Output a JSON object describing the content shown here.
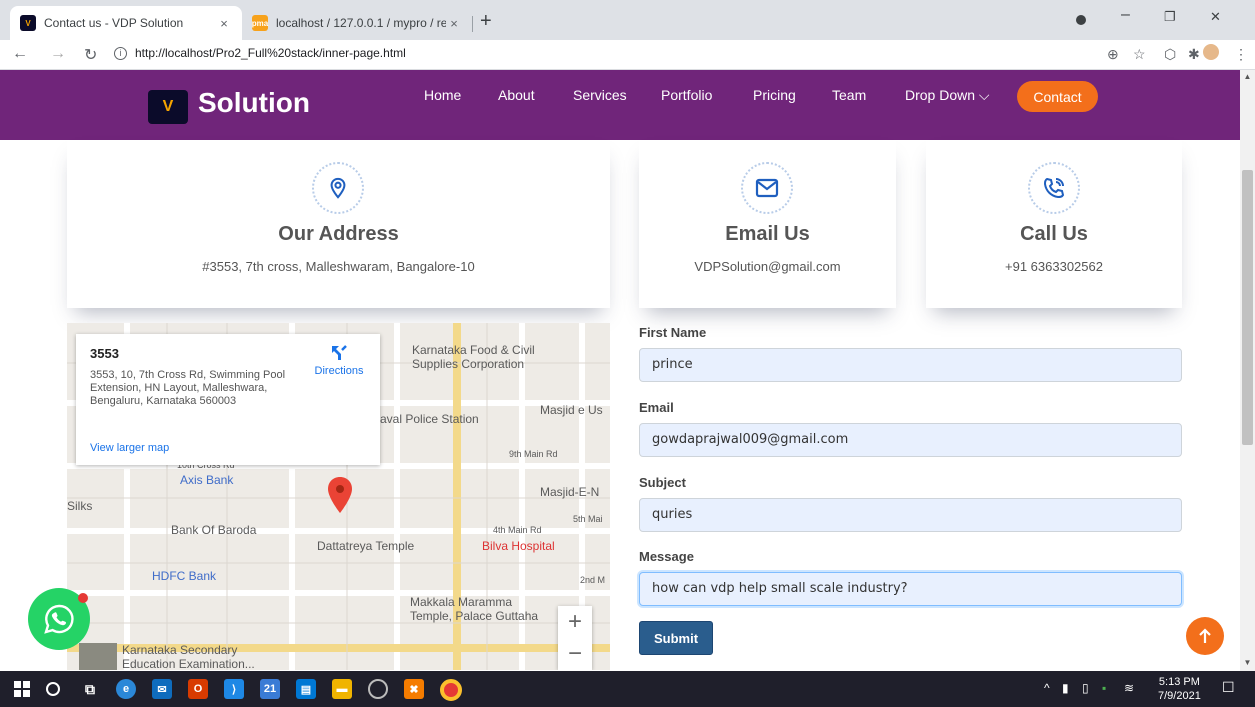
{
  "browser": {
    "tabs": [
      {
        "title": "Contact us - VDP Solution",
        "close": "×"
      },
      {
        "title": "localhost / 127.0.0.1 / mypro / re",
        "close": "×"
      }
    ],
    "new_tab": "+",
    "window_controls": {
      "minimize": "–",
      "maximize": "❐",
      "close": "✕"
    },
    "url": "http://localhost/Pro2_Full%20stack/inner-page.html"
  },
  "header": {
    "logo_mark": "V",
    "logo_text": "Solution",
    "nav": [
      "Home",
      "About",
      "Services",
      "Portfolio",
      "Pricing",
      "Team",
      "Drop Down ⌵"
    ],
    "contact_button": "Contact"
  },
  "info_boxes": [
    {
      "icon": "location-icon",
      "title": "Our Address",
      "text": "#3553, 7th cross, Malleshwaram, Bangalore-10"
    },
    {
      "icon": "envelope-icon",
      "title": "Email Us",
      "text": "VDPSolution@gmail.com"
    },
    {
      "icon": "phone-icon",
      "title": "Call Us",
      "text": "+91 6363302562"
    }
  ],
  "map": {
    "place": "3553",
    "address": "3553, 10, 7th Cross Rd, Swimming Pool Extension, HN Layout, Malleshwara, Bengaluru, Karnataka 560003",
    "directions": "Directions",
    "view_larger": "View larger map",
    "zoom_in": "+",
    "zoom_out": "−",
    "labels": {
      "karnataka_food": "Karnataka Food & Civil",
      "supplies": "Supplies Corporation",
      "masjid_e_u": "Masjid e Us",
      "police_station": "aval Police Station",
      "ninth_main": "9th Main Rd",
      "tenth_cross": "10th Cross Rd",
      "axis_bank": "Axis Bank",
      "silks": "Silks",
      "masjid_e_n": "Masjid-E-N",
      "fifth_main": "5th Mai",
      "bank_of_baroda": "Bank Of Baroda",
      "fourth_main": "4th Main Rd",
      "dattatreya": "Dattatreya Temple",
      "bilva": "Bilva Hospital",
      "hdfc": "HDFC Bank",
      "second_main": "2nd M",
      "makkala": "Makkala Maramma",
      "temple_palace": "Temple, Palace Guttaha",
      "karnataka_secondary": "Karnataka Secondary",
      "education_exam": "Education Examination..."
    }
  },
  "form": {
    "first_name_label": "First Name",
    "first_name_value": "prince",
    "email_label": "Email",
    "email_value": "gowdaprajwal009@gmail.com",
    "subject_label": "Subject",
    "subject_value": "quries",
    "message_label": "Message",
    "message_value": "how can vdp help small scale industry?",
    "submit": "Submit"
  },
  "taskbar": {
    "time": "5:13 PM",
    "date": "7/9/2021",
    "badge": "21"
  },
  "colors": {
    "header_bg": "#70257a",
    "accent_orange": "#f36f1b",
    "submit_blue": "#2a5d8d",
    "icon_blue": "#1f5fbf"
  }
}
